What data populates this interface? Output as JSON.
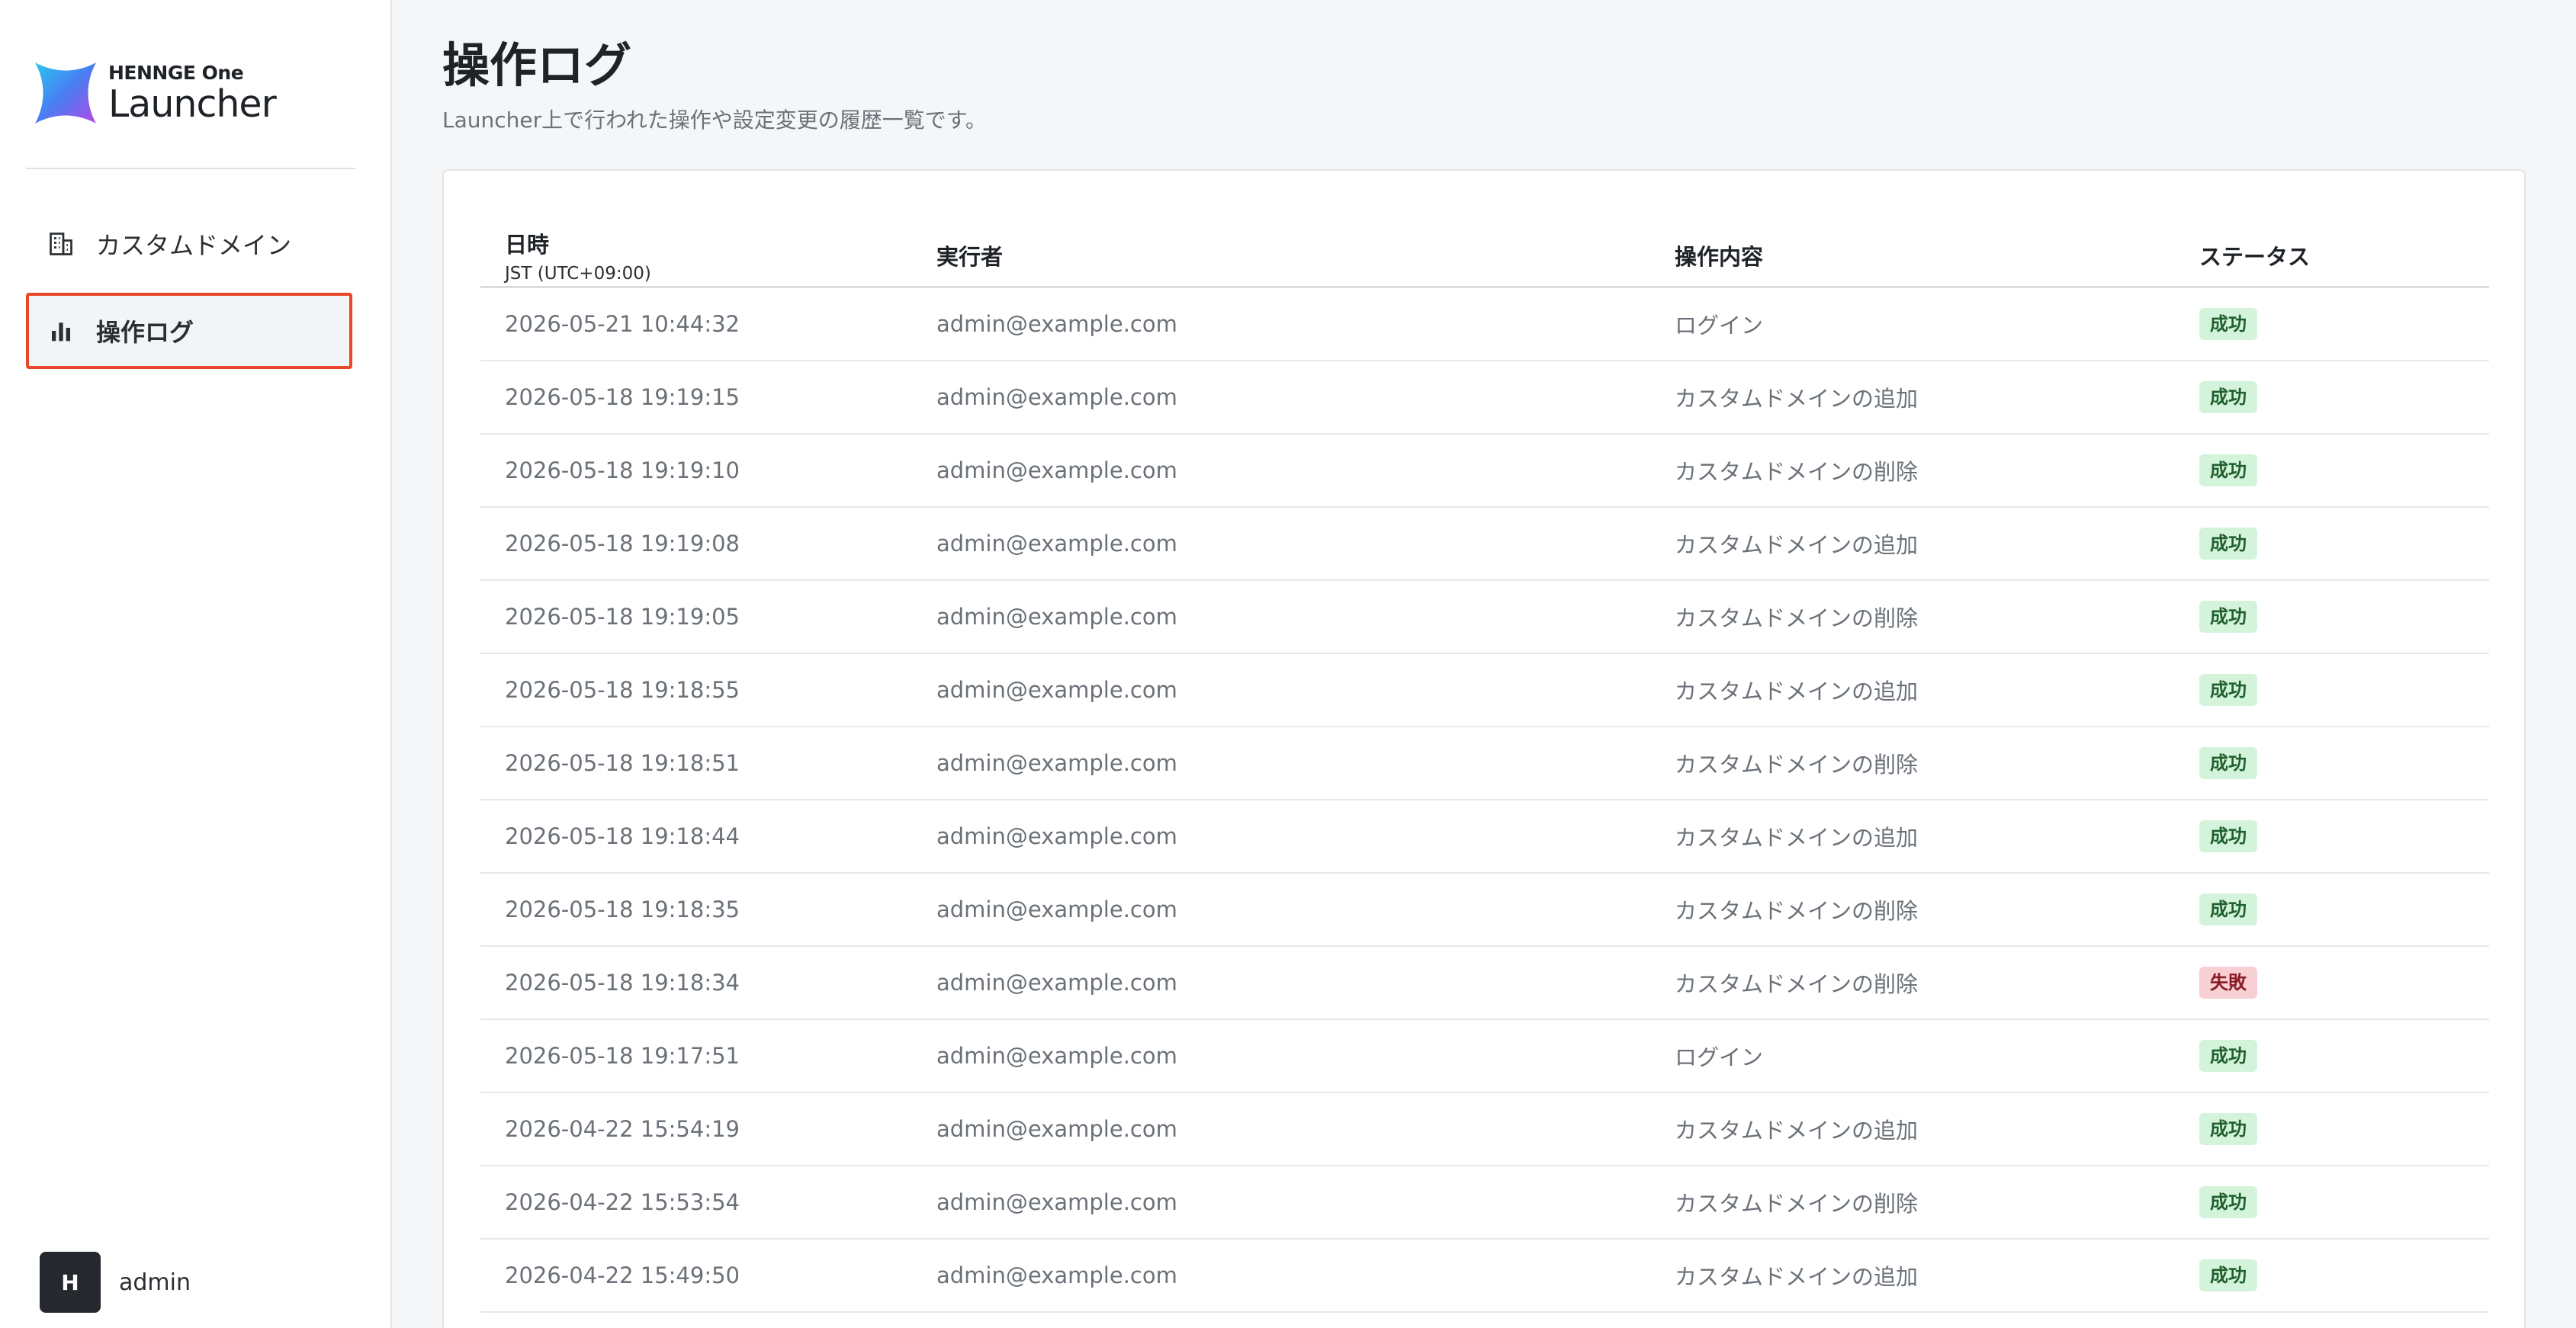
{
  "brand": {
    "top": "HENNGE One",
    "name": "Launcher"
  },
  "sidebar": {
    "items": [
      {
        "label": "カスタムドメイン",
        "icon": "building-icon",
        "active": false
      },
      {
        "label": "操作ログ",
        "icon": "bar-chart-icon",
        "active": true
      }
    ]
  },
  "user": {
    "initial": "H",
    "name": "admin"
  },
  "page": {
    "title": "操作ログ",
    "subtitle": "Launcher上で行われた操作や設定変更の履歴一覧です。"
  },
  "table": {
    "columns": {
      "date": "日時",
      "date_sub": "JST (UTC+09:00)",
      "actor": "実行者",
      "operation": "操作内容",
      "status": "ステータス"
    },
    "rows": [
      {
        "date": "2026-05-21 10:44:32",
        "actor": "admin@example.com",
        "operation": "ログイン",
        "status": "成功",
        "status_type": "success"
      },
      {
        "date": "2026-05-18 19:19:15",
        "actor": "admin@example.com",
        "operation": "カスタムドメインの追加",
        "status": "成功",
        "status_type": "success"
      },
      {
        "date": "2026-05-18 19:19:10",
        "actor": "admin@example.com",
        "operation": "カスタムドメインの削除",
        "status": "成功",
        "status_type": "success"
      },
      {
        "date": "2026-05-18 19:19:08",
        "actor": "admin@example.com",
        "operation": "カスタムドメインの追加",
        "status": "成功",
        "status_type": "success"
      },
      {
        "date": "2026-05-18 19:19:05",
        "actor": "admin@example.com",
        "operation": "カスタムドメインの削除",
        "status": "成功",
        "status_type": "success"
      },
      {
        "date": "2026-05-18 19:18:55",
        "actor": "admin@example.com",
        "operation": "カスタムドメインの追加",
        "status": "成功",
        "status_type": "success"
      },
      {
        "date": "2026-05-18 19:18:51",
        "actor": "admin@example.com",
        "operation": "カスタムドメインの削除",
        "status": "成功",
        "status_type": "success"
      },
      {
        "date": "2026-05-18 19:18:44",
        "actor": "admin@example.com",
        "operation": "カスタムドメインの追加",
        "status": "成功",
        "status_type": "success"
      },
      {
        "date": "2026-05-18 19:18:35",
        "actor": "admin@example.com",
        "operation": "カスタムドメインの削除",
        "status": "成功",
        "status_type": "success"
      },
      {
        "date": "2026-05-18 19:18:34",
        "actor": "admin@example.com",
        "operation": "カスタムドメインの削除",
        "status": "失敗",
        "status_type": "failure"
      },
      {
        "date": "2026-05-18 19:17:51",
        "actor": "admin@example.com",
        "operation": "ログイン",
        "status": "成功",
        "status_type": "success"
      },
      {
        "date": "2026-04-22 15:54:19",
        "actor": "admin@example.com",
        "operation": "カスタムドメインの追加",
        "status": "成功",
        "status_type": "success"
      },
      {
        "date": "2026-04-22 15:53:54",
        "actor": "admin@example.com",
        "operation": "カスタムドメインの削除",
        "status": "成功",
        "status_type": "success"
      },
      {
        "date": "2026-04-22 15:49:50",
        "actor": "admin@example.com",
        "operation": "カスタムドメインの追加",
        "status": "成功",
        "status_type": "success"
      }
    ]
  },
  "colors": {
    "accent_outline": "#e8472a",
    "success_bg": "#d3f3da",
    "failure_bg": "#f8cfd3"
  }
}
